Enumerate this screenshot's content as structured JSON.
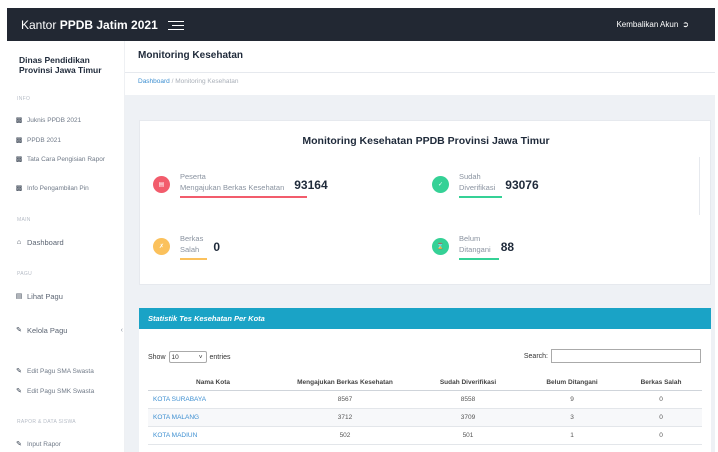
{
  "topbar": {
    "brand_prefix": "Kantor ",
    "brand_bold": "PPDB Jatim 2021",
    "kembalikan_label": "Kembalikan Akun",
    "menu_icon": "hamburger-icon",
    "logout_icon": "logout-icon"
  },
  "sidebar": {
    "title": "Dinas Pendidikan Provinsi Jawa Timur",
    "section_info": "INFO",
    "items_info": [
      {
        "label": "Juknis PPDB 2021",
        "icon": "book-icon"
      },
      {
        "label": "PPDB 2021",
        "icon": "book-icon"
      },
      {
        "label": "Tata Cara Pengisian Rapor",
        "icon": "book-icon"
      },
      {
        "label": "Info Pengambilan Pin",
        "icon": "book-icon"
      }
    ],
    "section_main": "MAIN",
    "dashboard_label": "Dashboard",
    "section_pagu": "PAGU",
    "lihat_pagu_label": "Lihat Pagu",
    "kelola_pagu_label": "Kelola Pagu",
    "edit_sma_label": "Edit Pagu SMA Swasta",
    "edit_smk_label": "Edit Pagu SMK Swasta",
    "section_rapor": "RAPOR & DATA SISWA",
    "input_rapor_label": "Input Rapor"
  },
  "header": {
    "page_title": "Monitoring Kesehatan",
    "breadcrumb_home": "Dashboard",
    "breadcrumb_sep": "/",
    "breadcrumb_current": "Monitoring Kesehatan"
  },
  "summary": {
    "title": "Monitoring Kesehatan PPDB Provinsi Jawa Timur",
    "stats": [
      {
        "label_1": "Peserta",
        "label_2": "Mengajukan Berkas Kesehatan",
        "value": "93164",
        "color": "#f25c6c"
      },
      {
        "label_1": "Sudah",
        "label_2": "Diverifikasi",
        "value": "93076",
        "color": "#35d196"
      },
      {
        "label_1": "Berkas",
        "label_2": "Salah",
        "value": "0",
        "color": "#fbc15c"
      },
      {
        "label_1": "Belum",
        "label_2": "Ditangani",
        "value": "88",
        "color": "#35d196"
      }
    ]
  },
  "table": {
    "heading": "Statistik Tes Kesehatan Per Kota",
    "show_label": "Show",
    "entries_value": "10",
    "entries_label": "entries",
    "search_label": "Search:",
    "search_value": "",
    "columns": [
      "Nama Kota",
      "Mengajukan Berkas Kesehatan",
      "Sudah Diverifikasi",
      "Belum Ditangani",
      "Berkas Salah"
    ],
    "rows": [
      [
        "KOTA SURABAYA",
        "8567",
        "8558",
        "9",
        "0"
      ],
      [
        "KOTA MALANG",
        "3712",
        "3709",
        "3",
        "0"
      ],
      [
        "KOTA MADIUN",
        "502",
        "501",
        "1",
        "0"
      ]
    ]
  }
}
